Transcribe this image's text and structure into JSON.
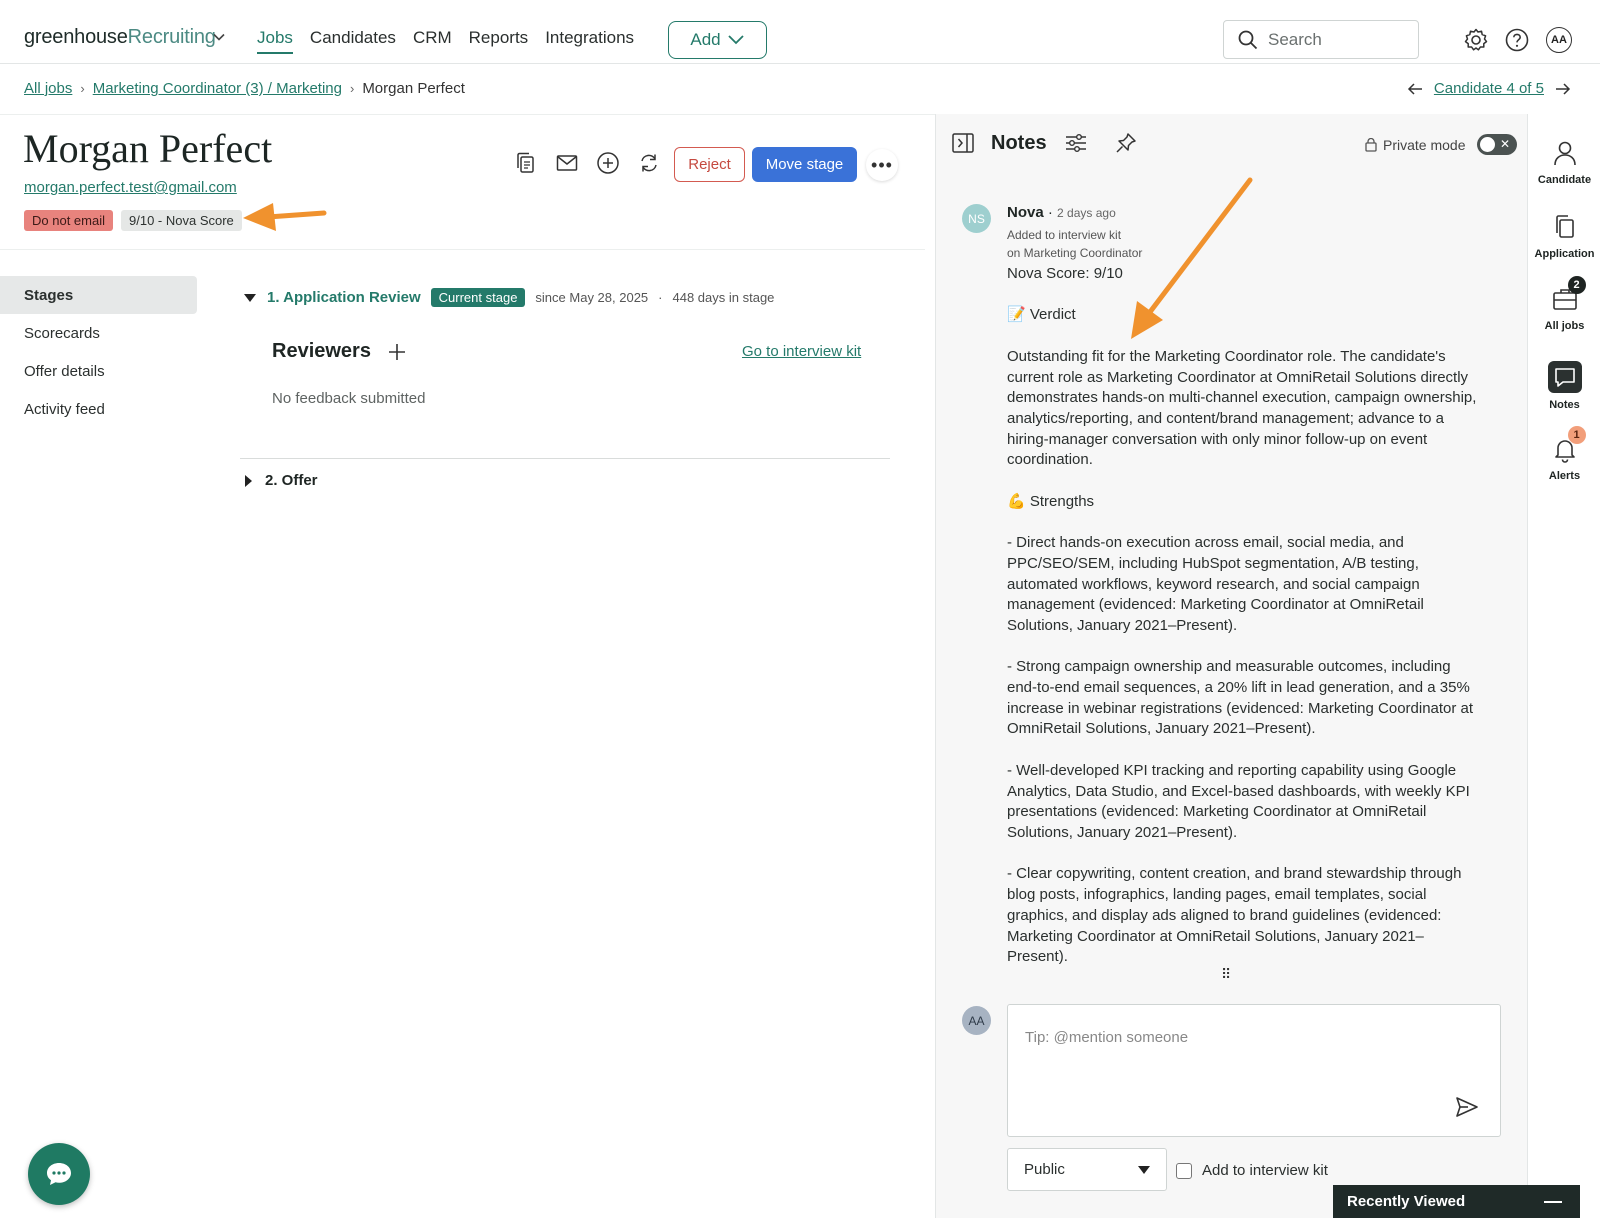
{
  "topbar": {
    "logo_main": "greenhouse",
    "logo_product": "Recruiting",
    "nav": [
      "Jobs",
      "Candidates",
      "CRM",
      "Reports",
      "Integrations"
    ],
    "add_label": "Add",
    "search_placeholder": "Search",
    "user_initials": "AA"
  },
  "breadcrumb": {
    "all_jobs": "All jobs",
    "job": "Marketing Coordinator (3) / Marketing",
    "current": "Morgan Perfect",
    "candidate_position": "Candidate 4 of 5"
  },
  "candidate": {
    "name": "Morgan Perfect",
    "email": "morgan.perfect.test@gmail.com",
    "tags": [
      "Do not email",
      "9/10 - Nova Score"
    ]
  },
  "actions": {
    "reject": "Reject",
    "move_stage": "Move stage",
    "more": "•••"
  },
  "side_menu": [
    "Stages",
    "Scorecards",
    "Offer details",
    "Activity feed"
  ],
  "stages": {
    "stage1_title": "1. Application Review",
    "current_badge": "Current stage",
    "since": "since May 28, 2025",
    "dot": "·",
    "days": "448 days in stage",
    "reviewers": "Reviewers",
    "go_to_kit": "Go to interview kit",
    "no_feedback": "No feedback submitted",
    "stage2_title": "2. Offer"
  },
  "notes": {
    "title": "Notes",
    "private_mode": "Private mode",
    "author_initials": "NS",
    "author": "Nova",
    "ago": "2 days ago",
    "sub1": "Added to interview kit",
    "sub2": "on Marketing Coordinator",
    "body": "Nova Score: 9/10\n\n📝 Verdict\n\nOutstanding fit for the Marketing Coordinator role. The candidate's current role as Marketing Coordinator at OmniRetail Solutions directly demonstrates hands-on multi-channel execution, campaign ownership, analytics/reporting, and content/brand management; advance to a hiring-manager conversation with only minor follow-up on event coordination.\n\n💪 Strengths\n\n- Direct hands-on execution across email, social media, and PPC/SEO/SEM, including HubSpot segmentation, A/B testing, automated workflows, keyword research, and social campaign management (evidenced: Marketing Coordinator at OmniRetail Solutions, January 2021–Present).\n\n- Strong campaign ownership and measurable outcomes, including end-to-end email sequences, a 20% lift in lead generation, and a 35% increase in webinar registrations (evidenced: Marketing Coordinator at OmniRetail Solutions, January 2021–Present).\n\n- Well-developed KPI tracking and reporting capability using Google Analytics, Data Studio, and Excel-based dashboards, with weekly KPI presentations (evidenced: Marketing Coordinator at OmniRetail Solutions, January 2021–Present).\n\n- Clear copywriting, content creation, and brand stewardship through blog posts, infographics, landing pages, email templates, social graphics, and display ads aligned to brand guidelines (evidenced: Marketing Coordinator at OmniRetail Solutions, January 2021–Present).",
    "input_placeholder": "Tip: @mention someone",
    "user_initials": "AA",
    "visibility": "Public",
    "add_to_kit": "Add to interview kit"
  },
  "rail": {
    "items": [
      "Candidate",
      "Application",
      "All jobs",
      "Notes",
      "Alerts"
    ],
    "all_jobs_badge": "2",
    "alerts_badge": "1"
  },
  "recently_viewed": "Recently Viewed",
  "colors": {
    "brand_green": "#247a6a",
    "primary_blue": "#3a72d8",
    "reject_red": "#d35a50",
    "annotation_orange": "#f0922e"
  }
}
